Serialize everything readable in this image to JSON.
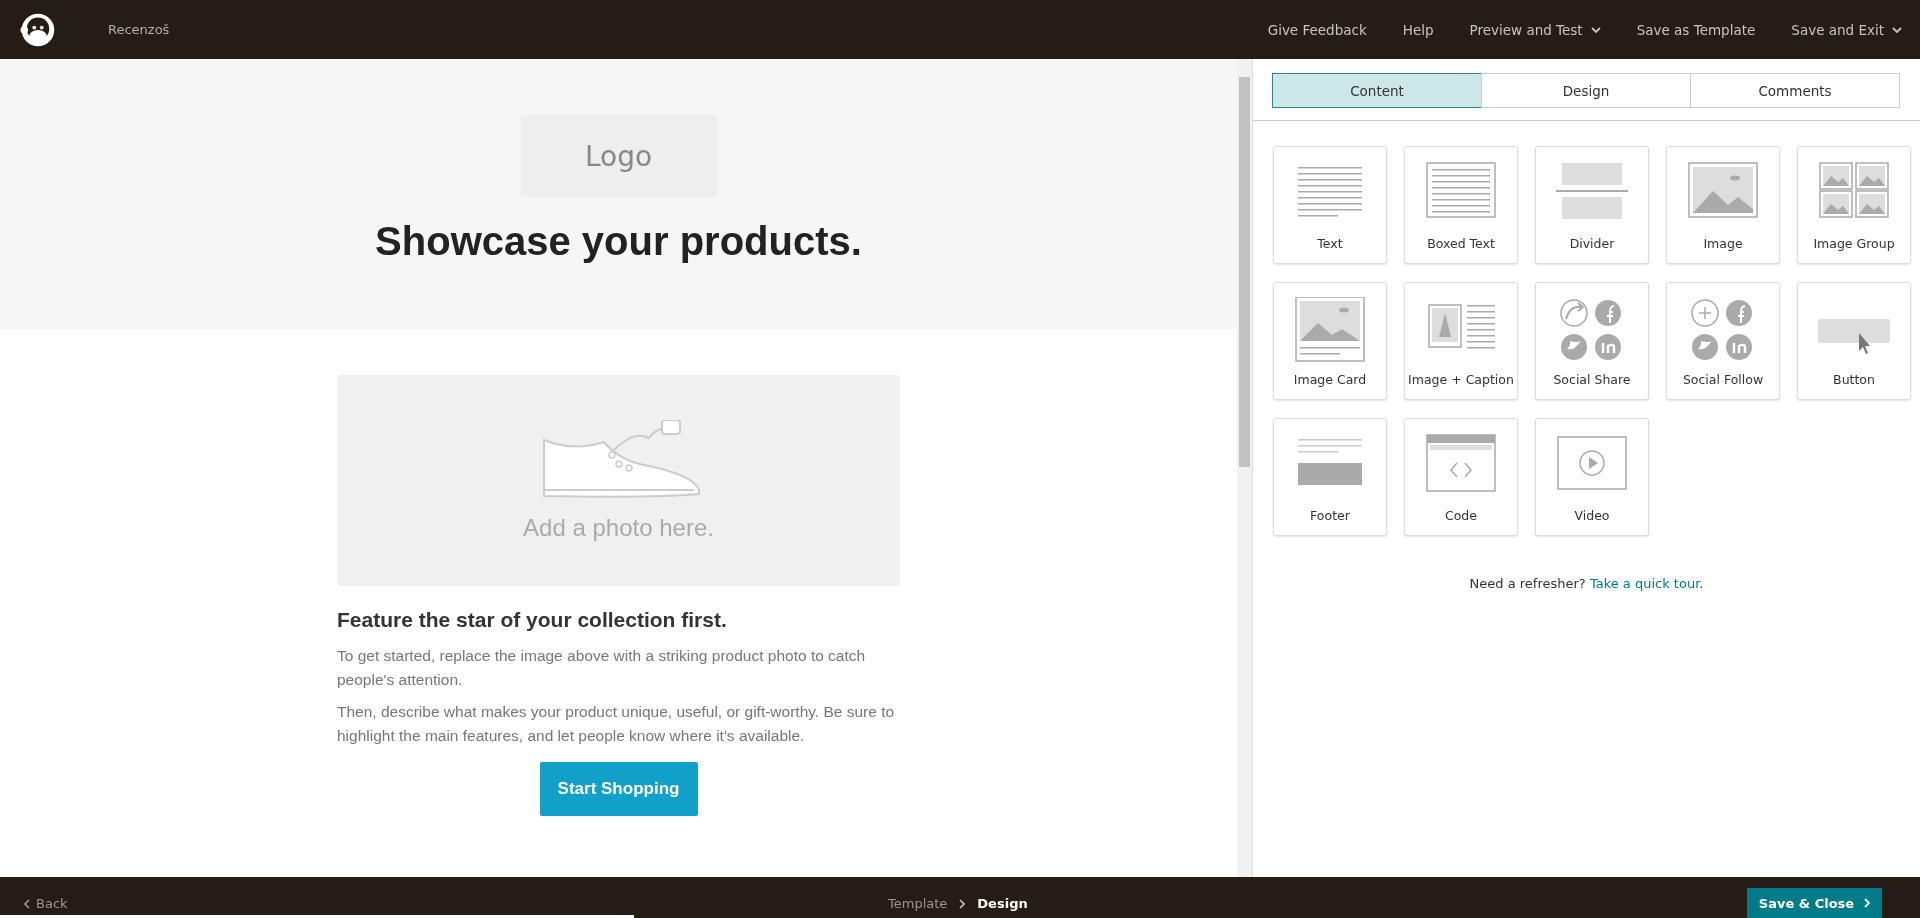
{
  "top_bar": {
    "account": "Recenzoš",
    "links": [
      {
        "label": "Give Feedback",
        "dropdown": false
      },
      {
        "label": "Help",
        "dropdown": false
      },
      {
        "label": "Preview and Test",
        "dropdown": true
      },
      {
        "label": "Save as Template",
        "dropdown": false
      },
      {
        "label": "Save and Exit",
        "dropdown": true
      }
    ]
  },
  "email": {
    "logo_placeholder": "Logo",
    "headline": "Showcase your products.",
    "photo_placeholder": "Add a photo here.",
    "heading": "Feature the star of your collection first.",
    "paragraphs": [
      "To get started, replace the image above with a striking product photo to catch people's attention.",
      "Then, describe what makes your product unique, useful, or gift-worthy. Be sure to highlight the main features, and let people know where it's available."
    ],
    "cta": "Start Shopping"
  },
  "panel": {
    "tabs": [
      {
        "label": "Content",
        "selected": true
      },
      {
        "label": "Design",
        "selected": false
      },
      {
        "label": "Comments",
        "selected": false
      }
    ],
    "blocks": [
      {
        "label": "Text",
        "kind": "text"
      },
      {
        "label": "Boxed Text",
        "kind": "boxed"
      },
      {
        "label": "Divider",
        "kind": "divider"
      },
      {
        "label": "Image",
        "kind": "image"
      },
      {
        "label": "Image Group",
        "kind": "group"
      },
      {
        "label": "Image Card",
        "kind": "card"
      },
      {
        "label": "Image + Caption",
        "kind": "caption"
      },
      {
        "label": "Social Share",
        "kind": "share"
      },
      {
        "label": "Social Follow",
        "kind": "follow"
      },
      {
        "label": "Button",
        "kind": "button"
      },
      {
        "label": "Footer",
        "kind": "footer"
      },
      {
        "label": "Code",
        "kind": "code"
      },
      {
        "label": "Video",
        "kind": "video"
      }
    ],
    "tour_prompt": "Need a refresher?",
    "tour_link": "Take a quick tour",
    "tour_end": "."
  },
  "bottom_bar": {
    "back": "Back",
    "progress": {
      "level": 0.33
    },
    "steps": [
      {
        "label": "Template",
        "selected": false
      },
      {
        "label": "Design",
        "selected": true
      }
    ],
    "save": "Save & Close"
  }
}
